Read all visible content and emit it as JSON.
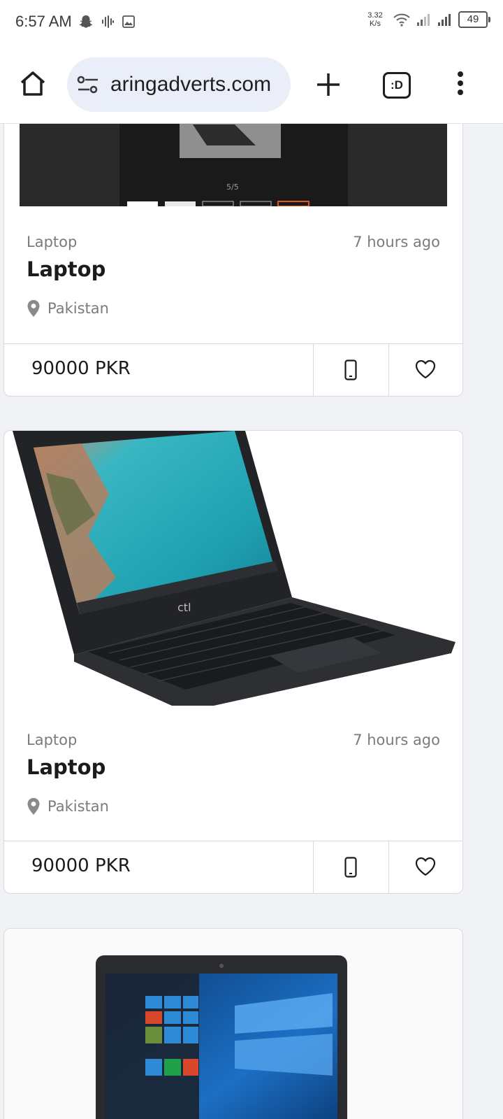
{
  "status_bar": {
    "time": "6:57 AM",
    "net_speed_value": "3.32",
    "net_speed_unit": "K/s",
    "battery": "49"
  },
  "browser": {
    "url": "aringadverts.com",
    "tab_switcher_label": ":D"
  },
  "listings": [
    {
      "category": "Laptop",
      "time_ago": "7 hours ago",
      "title": "Laptop",
      "location": "Pakistan",
      "price": "90000 PKR",
      "gallery_counter": "5/5"
    },
    {
      "category": "Laptop",
      "time_ago": "7 hours ago",
      "title": "Laptop",
      "location": "Pakistan",
      "price": "90000 PKR"
    }
  ],
  "icons": {
    "home": "home-icon",
    "site_settings": "tune-icon",
    "new_tab": "plus-icon",
    "menu": "more-vert-icon",
    "location": "location-pin-icon",
    "phone": "phone-icon",
    "favorite": "heart-icon"
  }
}
